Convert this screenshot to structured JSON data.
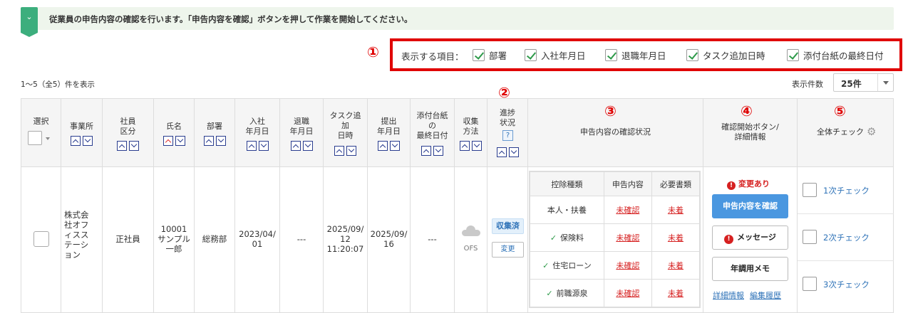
{
  "banner": {
    "text": "従業員の申告内容の確認を行います。「申告内容を確認」ボタンを押して作業を開始してください。"
  },
  "callouts": [
    "①",
    "②",
    "③",
    "④",
    "⑤"
  ],
  "display_items": {
    "label": "表示する項目：",
    "items": [
      {
        "label": "部署",
        "checked": true
      },
      {
        "label": "入社年月日",
        "checked": true
      },
      {
        "label": "退職年月日",
        "checked": true
      },
      {
        "label": "タスク追加日時",
        "checked": true
      },
      {
        "label": "添付台紙の最終日付",
        "checked": true
      }
    ]
  },
  "count_text": "1～5（全5）件を表示",
  "per_page": {
    "label": "表示件数",
    "value": "25件"
  },
  "columns": {
    "select": "選択",
    "office": "事業所",
    "employee_type": [
      "社員",
      "区分"
    ],
    "name": "氏名",
    "dept": "部署",
    "join_date": [
      "入社",
      "年月日"
    ],
    "retire_date": [
      "退職",
      "年月日"
    ],
    "task_added": [
      "タスク追",
      "加",
      "日時"
    ],
    "submit_date": [
      "提出",
      "年月日"
    ],
    "attach_date": [
      "添付台紙",
      "の",
      "最終日付"
    ],
    "collect": [
      "収集",
      "方法"
    ],
    "progress": [
      "進捗",
      "状況"
    ],
    "progress_help": "?",
    "confirm_status": "申告内容の確認状況",
    "confirm_btn": [
      "確認開始ボタン/",
      "詳細情報"
    ],
    "overall_check": "全体チェック"
  },
  "row": {
    "office": [
      "株式会",
      "社オフ",
      "ィスス",
      "テーシ",
      "ョン"
    ],
    "employee_type": "正社員",
    "name": [
      "10001",
      "サンプル",
      "一郎"
    ],
    "dept": "総務部",
    "join_date": [
      "2023/04/",
      "01"
    ],
    "retire_date": "---",
    "task_added": [
      "2025/09/",
      "12",
      "11:20:07"
    ],
    "submit_date": [
      "2025/09/",
      "16"
    ],
    "attach_date": "---",
    "collect": "OFS",
    "progress_status": "収集済",
    "progress_change": "変更",
    "confirm_table": {
      "headers": [
        "控除種類",
        "申告内容",
        "必要書類"
      ],
      "rows": [
        {
          "type": "本人・扶養",
          "checked": false,
          "content": "未確認",
          "docs": "未着"
        },
        {
          "type": "保険料",
          "checked": true,
          "content": "未確認",
          "docs": "未着"
        },
        {
          "type": "住宅ローン",
          "checked": true,
          "content": "未確認",
          "docs": "未着"
        },
        {
          "type": "前職源泉",
          "checked": true,
          "content": "未確認",
          "docs": "未着"
        }
      ]
    },
    "change_notice": "変更あり",
    "confirm_button": "申告内容を確認",
    "message_button": "メッセージ",
    "memo_button": "年調用メモ",
    "detail_link": "詳細情報",
    "history_link": "編集履歴",
    "checks": [
      "1次チェック",
      "2次チェック",
      "3次チェック"
    ]
  },
  "colors": {
    "accent_red": "#e00000",
    "link_blue": "#2f73b8",
    "button_blue": "#4a97e0",
    "banner_green": "#3cae7d"
  }
}
